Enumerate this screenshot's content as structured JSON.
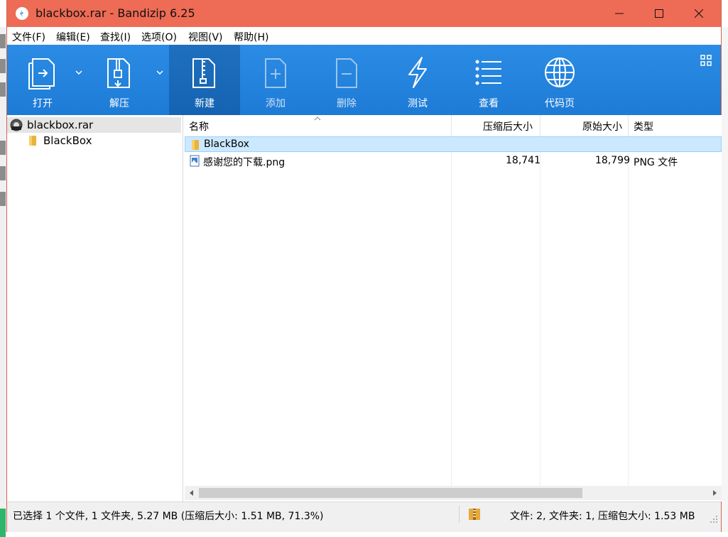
{
  "window": {
    "title": "blackbox.rar - Bandizip 6.25",
    "accent": "#ee6b55"
  },
  "menu": [
    {
      "label": "文件(F)"
    },
    {
      "label": "编辑(E)"
    },
    {
      "label": "查找(I)"
    },
    {
      "label": "选项(O)"
    },
    {
      "label": "视图(V)"
    },
    {
      "label": "帮助(H)"
    }
  ],
  "toolbar": {
    "open": "打开",
    "extract": "解压",
    "new": "新建",
    "add": "添加",
    "delete": "删除",
    "test": "测试",
    "view": "查看",
    "codepage": "代码页",
    "color": "#2b8ce5"
  },
  "tree": {
    "root": "blackbox.rar",
    "child": "BlackBox"
  },
  "list": {
    "columns": {
      "name": "名称",
      "packed": "压缩后大小",
      "original": "原始大小",
      "type": "类型"
    },
    "rows": [
      {
        "name": "BlackBox",
        "packed": "",
        "original": "",
        "type": ""
      },
      {
        "name": "感谢您的下载.png",
        "packed": "18,741",
        "original": "18,799",
        "type": "PNG 文件"
      }
    ]
  },
  "status": {
    "left": "已选择 1 个文件, 1 文件夹, 5.27 MB (压缩后大小: 1.51 MB, 71.3%)",
    "right": "文件: 2, 文件夹: 1, 压缩包大小: 1.53 MB"
  }
}
